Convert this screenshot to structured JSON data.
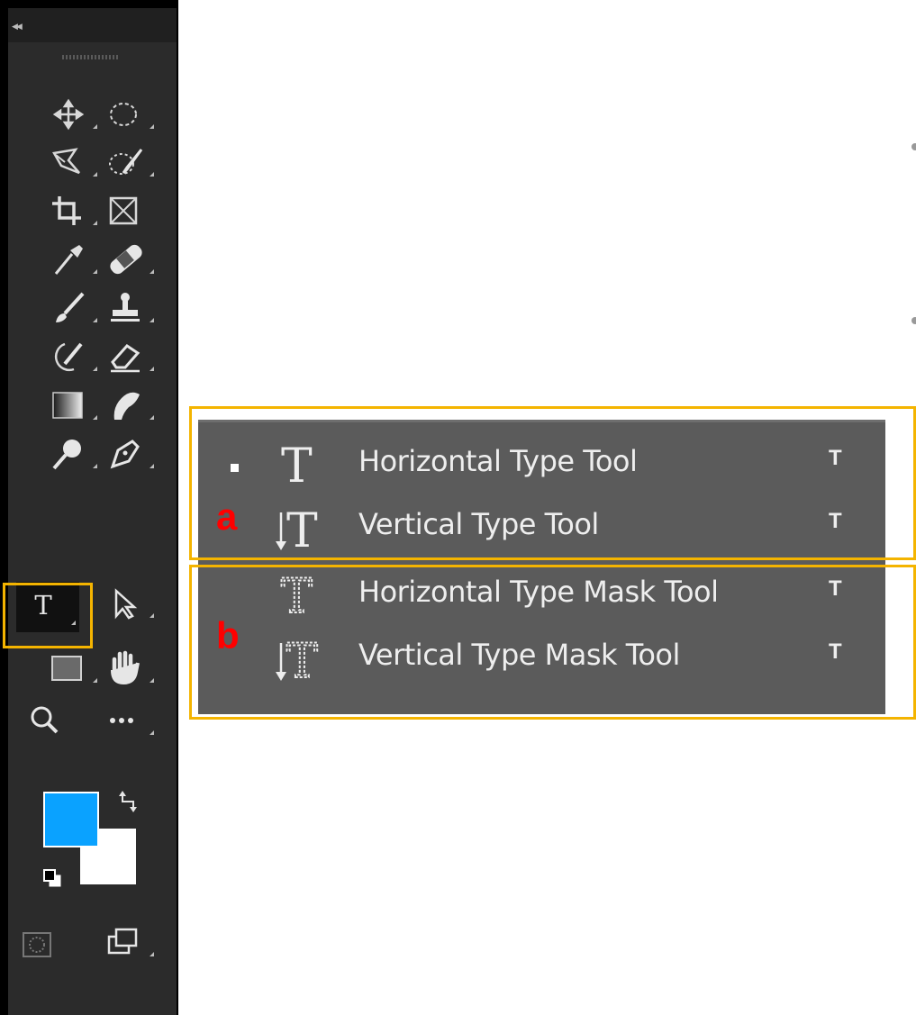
{
  "toolbar": {
    "collapse_icon": "double-chevron-left-icon",
    "tools": [
      {
        "name": "move-tool",
        "icon": "move-arrows-icon"
      },
      {
        "name": "elliptical-marquee-tool",
        "icon": "dashed-ellipse-icon"
      },
      {
        "name": "lasso-tool",
        "icon": "lasso-icon"
      },
      {
        "name": "quick-selection-tool",
        "icon": "quick-selection-brush-icon"
      },
      {
        "name": "crop-tool",
        "icon": "crop-icon"
      },
      {
        "name": "frame-tool",
        "icon": "frame-x-icon"
      },
      {
        "name": "eyedropper-tool",
        "icon": "eyedropper-icon"
      },
      {
        "name": "healing-brush-tool",
        "icon": "bandage-icon"
      },
      {
        "name": "brush-tool",
        "icon": "brush-icon"
      },
      {
        "name": "clone-stamp-tool",
        "icon": "stamp-icon"
      },
      {
        "name": "history-brush-tool",
        "icon": "history-brush-icon"
      },
      {
        "name": "eraser-tool",
        "icon": "eraser-icon"
      },
      {
        "name": "gradient-tool",
        "icon": "gradient-icon"
      },
      {
        "name": "smudge-tool",
        "icon": "smudge-finger-icon"
      },
      {
        "name": "dodge-tool",
        "icon": "dodge-icon"
      },
      {
        "name": "pen-tool",
        "icon": "pen-nib-icon"
      },
      {
        "name": "type-tool",
        "icon": "type-t-icon",
        "glyph": "T",
        "active": true
      },
      {
        "name": "path-selection-tool",
        "icon": "arrow-cursor-icon"
      },
      {
        "name": "rectangle-tool",
        "icon": "rectangle-icon"
      },
      {
        "name": "hand-tool",
        "icon": "hand-icon"
      },
      {
        "name": "zoom-tool",
        "icon": "magnifier-icon"
      },
      {
        "name": "edit-toolbar",
        "icon": "more-dots-icon"
      },
      {
        "name": "quick-mask-mode",
        "icon": "quick-mask-icon"
      },
      {
        "name": "screen-mode",
        "icon": "screen-mode-icon"
      }
    ],
    "colors": {
      "foreground": "#0aa2ff",
      "background": "#ffffff",
      "toolbar_bg": "#2b2b2b",
      "highlight": "#f4b400"
    }
  },
  "flyout": {
    "items": [
      {
        "label": "Horizontal Type Tool",
        "shortcut": "T",
        "icon": "horizontal-type-icon",
        "selected": true
      },
      {
        "label": "Vertical Type Tool",
        "shortcut": "T",
        "icon": "vertical-type-icon",
        "selected": false
      },
      {
        "label": "Horizontal Type Mask Tool",
        "shortcut": "T",
        "icon": "horizontal-type-mask-icon",
        "selected": false
      },
      {
        "label": "Vertical Type Mask Tool",
        "shortcut": "T",
        "icon": "vertical-type-mask-icon",
        "selected": false
      }
    ],
    "background": "#5b5b5b"
  },
  "annotations": {
    "group_a_label": "a",
    "group_b_label": "b",
    "label_color": "#ff0000",
    "box_color": "#f4b400"
  }
}
